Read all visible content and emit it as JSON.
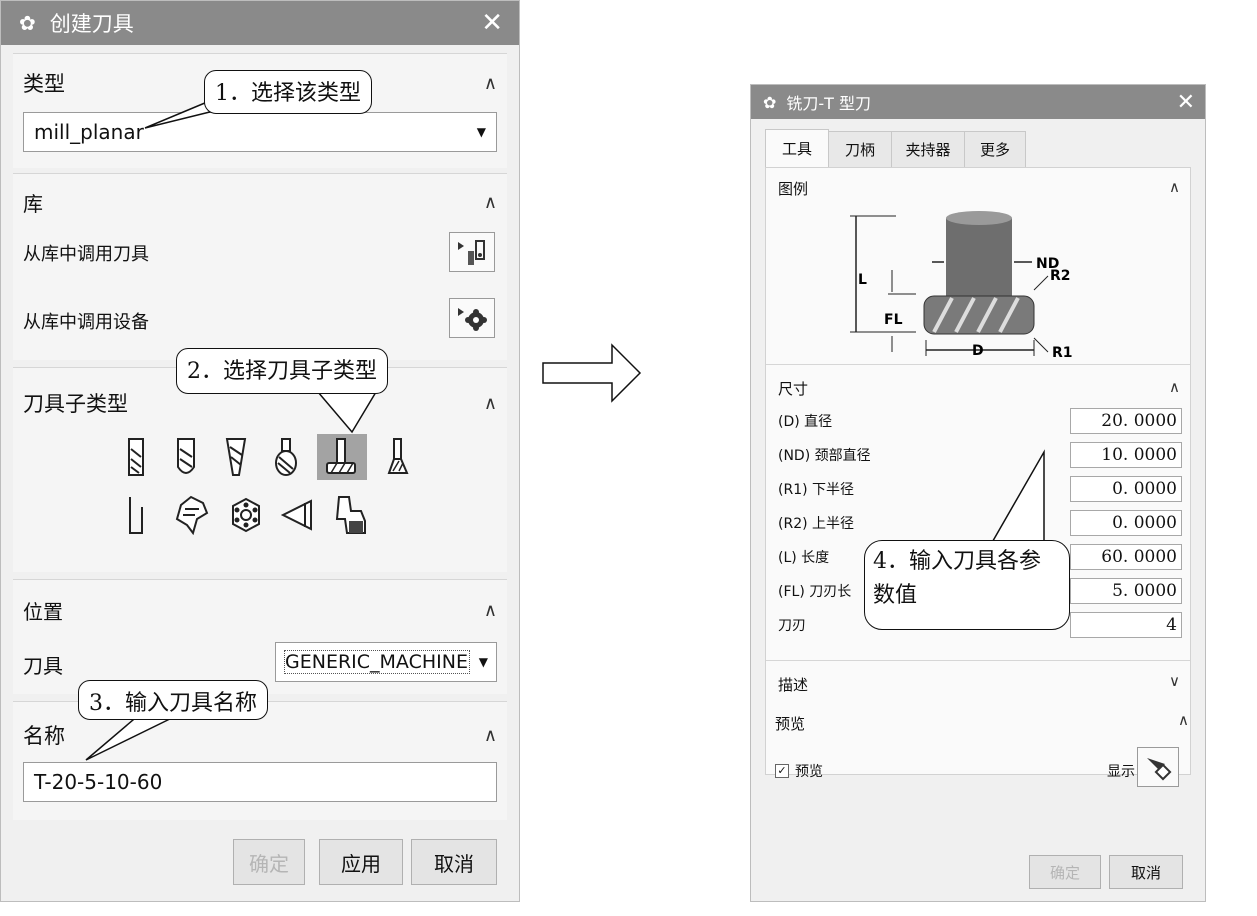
{
  "dialog1": {
    "title": "创建刀具",
    "type_section": {
      "label": "类型",
      "value": "mill_planar"
    },
    "library_section": {
      "label": "库",
      "load_tool": "从库中调用刀具",
      "load_device": "从库中调用设备"
    },
    "subtype_section": {
      "label": "刀具子类型",
      "selected_index": 4,
      "row1": [
        "end-mill-icon",
        "ball-mill-icon",
        "taper-mill-icon",
        "barrel-mill-icon",
        "t-cutter-icon",
        "dovetail-mill-icon"
      ],
      "row2": [
        "thread-mill-icon",
        "chamfer-mill-icon",
        "face-mill-icon",
        "holder-icon",
        "turret-icon"
      ]
    },
    "location_section": {
      "label": "位置",
      "tool_label": "刀具",
      "tool_value": "GENERIC_MACHINE"
    },
    "name_section": {
      "label": "名称",
      "value": "T-20-5-10-60"
    },
    "buttons": {
      "ok": "确定",
      "apply": "应用",
      "cancel": "取消"
    }
  },
  "callouts": {
    "c1": "1．选择该类型",
    "c2": "2．选择刀具子类型",
    "c3": "3．输入刀具名称",
    "c4_line1": "4．输入刀具各参",
    "c4_line2": "数值"
  },
  "dialog2": {
    "title": "铣刀-T 型刀",
    "tabs": [
      "工具",
      "刀柄",
      "夹持器",
      "更多"
    ],
    "legend": {
      "label": "图例",
      "nd": "ND",
      "r2": "R2",
      "l": "L",
      "fl": "FL",
      "d": "D",
      "r1": "R1"
    },
    "dimensions": {
      "label": "尺寸",
      "fields": [
        {
          "label": "(D) 直径",
          "value": "20. 0000"
        },
        {
          "label": "(ND) 颈部直径",
          "value": "10. 0000"
        },
        {
          "label": "(R1) 下半径",
          "value": "0. 0000"
        },
        {
          "label": "(R2) 上半径",
          "value": "0. 0000"
        },
        {
          "label": "(L) 长度",
          "value": "60. 0000"
        },
        {
          "label": "(FL) 刀刃长",
          "value": "5. 0000"
        },
        {
          "label": "刀刃",
          "value": "4"
        }
      ]
    },
    "description": {
      "label": "描述"
    },
    "preview": {
      "label": "预览",
      "checkbox": "预览",
      "checked": true,
      "show": "显示"
    },
    "buttons": {
      "ok": "确定",
      "cancel": "取消"
    }
  }
}
